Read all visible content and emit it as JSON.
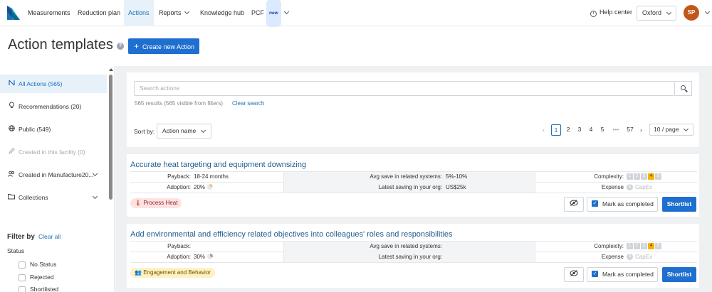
{
  "nav": {
    "items": [
      {
        "label": "Measurements"
      },
      {
        "label": "Reduction plan"
      },
      {
        "label": "Actions"
      },
      {
        "label": "Reports"
      },
      {
        "label": "Knowledge hub"
      },
      {
        "label": "PCF"
      }
    ],
    "new_badge": "new",
    "help": "Help center",
    "facility": "Oxford",
    "avatar": "SP"
  },
  "page": {
    "title": "Action templates",
    "help_icon": "?",
    "create_button": "Create new Action"
  },
  "sidebar": {
    "items": [
      {
        "label": "All Actions (565)",
        "icon": "logo-mark-icon"
      },
      {
        "label": "Recommendations (20)",
        "icon": "lightbulb-icon"
      },
      {
        "label": "Public (549)",
        "icon": "globe-icon"
      },
      {
        "label": "Created in this facility (0)",
        "icon": "pencil-icon"
      },
      {
        "label": "Created in Manufacture20...",
        "icon": "users-icon"
      },
      {
        "label": "Collections",
        "icon": "folder-icon"
      }
    ],
    "filter_title": "Filter by",
    "clear_all": "Clear all",
    "status_label": "Status",
    "status_options": [
      "No Status",
      "Rejected",
      "Shortlisted"
    ]
  },
  "search": {
    "placeholder": "Search actions",
    "results": "565 results (565 visible from filters)",
    "clear": "Clear search"
  },
  "sort": {
    "label": "Sort by:",
    "value": "Action name"
  },
  "pagination": {
    "pages": [
      "1",
      "2",
      "3",
      "4",
      "5"
    ],
    "ellipsis": "•••",
    "last": "57",
    "per_page": "10 / page",
    "current": 1
  },
  "actions": [
    {
      "title": "Accurate heat targeting and equipment downsizing",
      "payback_label": "Payback:",
      "payback": "18-24 months",
      "adoption_label": "Adoption:",
      "adoption": "20%",
      "avg_save_label": "Avg save in related systems:",
      "avg_save": "5%-10%",
      "latest_label": "Latest saving in your org:",
      "latest": "US$25k",
      "complexity_label": "Complexity:",
      "complexity": 4,
      "expense_label": "Expense",
      "expense": "CapEx",
      "tag": "Process Heat",
      "mark_label": "Mark as completed",
      "shortlist_label": "Shortlist"
    },
    {
      "title": "Add environmental and efficiency related objectives into colleagues' roles and responsibilities",
      "payback_label": "Payback:",
      "payback": "",
      "adoption_label": "Adoption:",
      "adoption": "30%",
      "avg_save_label": "Avg save in related systems:",
      "avg_save": "",
      "latest_label": "Latest saving in your org:",
      "latest": "",
      "complexity_label": "Complexity:",
      "complexity": 4,
      "expense_label": "Expense",
      "expense": "CapEx",
      "tag": "Engagement and Behavior",
      "mark_label": "Mark as completed",
      "shortlist_label": "Shortlist"
    }
  ],
  "colors": {
    "accent": "#1f6fd0",
    "link": "#1f5d8f",
    "complexity_on": "#f5b400"
  }
}
